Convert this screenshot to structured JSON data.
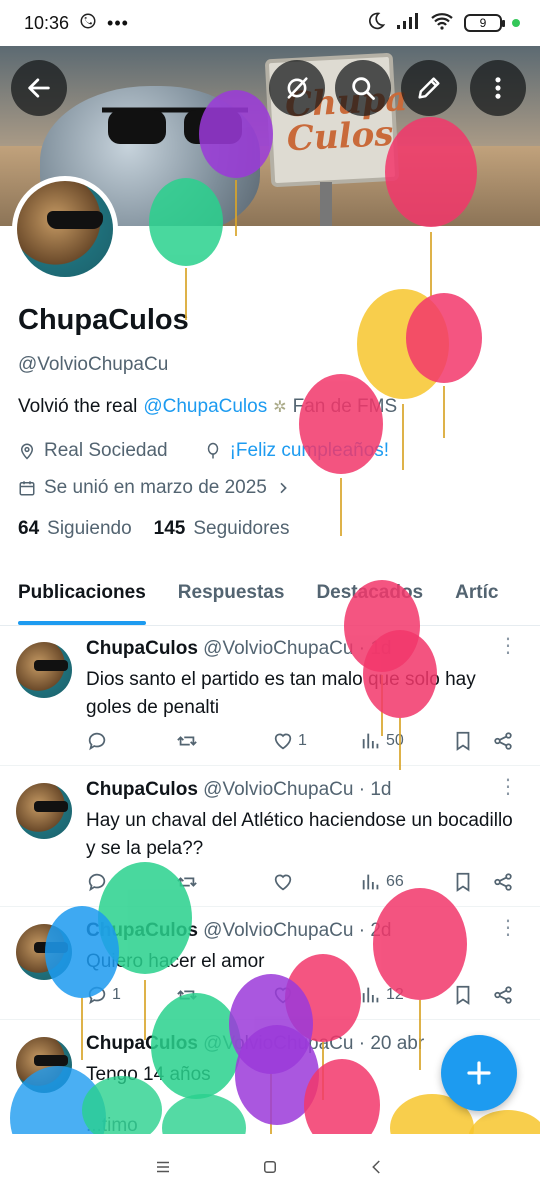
{
  "status_bar": {
    "time": "10:36",
    "battery": "9"
  },
  "profile": {
    "name": "ChupaCulos",
    "handle": "@VolvioChupaCu",
    "bio_prefix": "Volvió the real",
    "bio_mention": "@ChupaCulos",
    "bio_suffix": "Fan de FMS",
    "location": "Real Sociedad",
    "birthday": "¡Feliz cumpleaños!",
    "joined": "Se unió en marzo de 2025",
    "following_count": "64",
    "following_label": "Siguiendo",
    "followers_count": "145",
    "followers_label": "Seguidores",
    "banner_sign": "Chupa Culos"
  },
  "tabs": [
    "Publicaciones",
    "Respuestas",
    "Destacados",
    "Artíc"
  ],
  "posts": [
    {
      "name": "ChupaCulos",
      "meta": "@VolvioChupaCu · 1d",
      "text": "Dios santo el partido es tan malo que solo hay goles de penalti",
      "replies": "",
      "retweets": "",
      "likes": "1",
      "views": "50"
    },
    {
      "name": "ChupaCulos",
      "meta": "@VolvioChupaCu · 1d",
      "text": "Hay un chaval del Atlético haciendose un bocadillo y se la pela??",
      "replies": "",
      "retweets": "",
      "likes": "",
      "views": "66"
    },
    {
      "name": "ChupaCulos",
      "meta": "@VolvioChupaCu · 2d",
      "text": "Quiero hacer el amor",
      "replies": "1",
      "retweets": "",
      "likes": "",
      "views": "12"
    },
    {
      "name": "ChupaCulos",
      "meta": "@VolvioChupaCu · 20 abr",
      "text": "Tengo 14 años",
      "extra": "...timo"
    }
  ],
  "colors": {
    "accent": "#1d9bf0",
    "text": "#0f1419",
    "muted": "#536471"
  },
  "icons": [
    "back-arrow-icon",
    "grok-icon",
    "search-icon",
    "edit-icon",
    "more-vertical-icon",
    "location-pin-icon",
    "balloon-icon",
    "calendar-icon",
    "chevron-right-icon",
    "reply-icon",
    "retweet-icon",
    "heart-icon",
    "views-icon",
    "bookmark-icon",
    "share-icon",
    "plus-icon"
  ]
}
